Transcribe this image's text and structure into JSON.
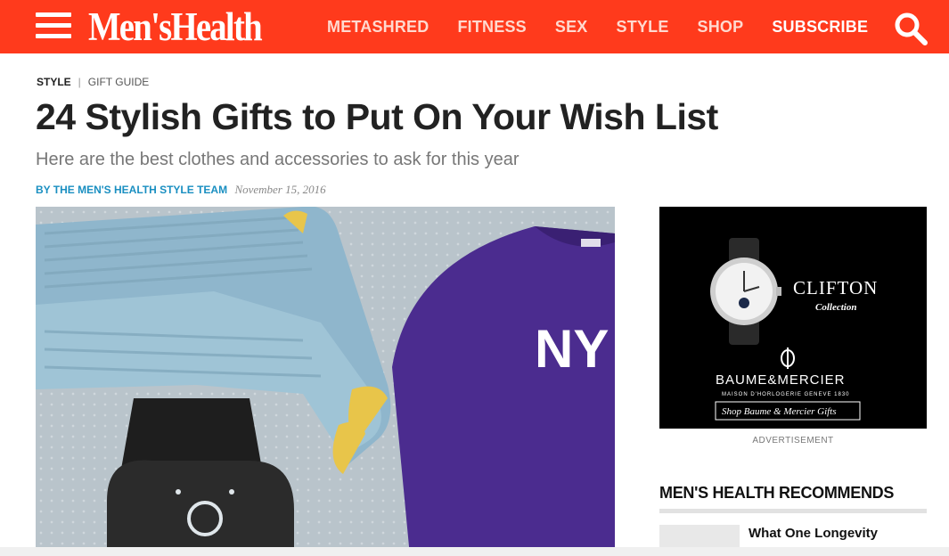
{
  "header": {
    "brand": "Men'sHealth",
    "nav": [
      "METASHRED",
      "FITNESS",
      "SEX",
      "STYLE",
      "SHOP",
      "SUBSCRIBE"
    ],
    "icons": {
      "menu": "hamburger-menu-icon",
      "search": "search-icon"
    },
    "colors": {
      "bar": "#ff3a1c",
      "nav_text": "#ffd9cf",
      "subscribe_text": "#ffffff"
    }
  },
  "breadcrumb": {
    "section": "STYLE",
    "separator": "|",
    "subsection": "GIFT GUIDE"
  },
  "article": {
    "title": "24 Stylish Gifts to Put On Your Wish List",
    "dek": "Here are the best clothes and accessories to ask for this year",
    "author": "BY THE MEN'S HEALTH STYLE TEAM",
    "date": "November 15, 2016",
    "hero_text": "NY"
  },
  "ad": {
    "headline": "CLIFTON",
    "subline": "Collection",
    "brand": "BAUME&MERCIER",
    "tagline": "MAISON D'HORLOGERIE GENEVE 1830",
    "cta": "Shop Baume & Mercier Gifts",
    "label": "ADVERTISEMENT"
  },
  "recommends": {
    "title": "MEN'S HEALTH RECOMMENDS",
    "items": [
      {
        "text": "What One Longevity"
      }
    ]
  },
  "colors": {
    "accent": "#ff3a1c",
    "byline": "#1a8fc1"
  }
}
